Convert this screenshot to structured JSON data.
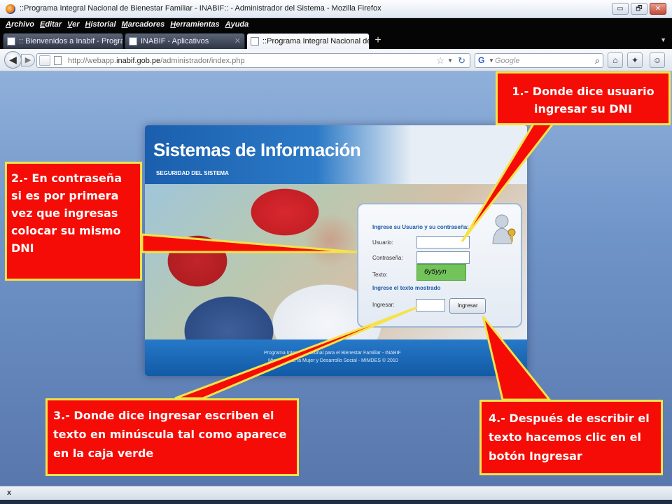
{
  "window": {
    "title": "::Programa Integral Nacional de Bienestar Familiar - INABIF:: - Administrador del Sistema - Mozilla Firefox",
    "minimize_label": "▭",
    "restore_label": "🗗",
    "close_label": "✕"
  },
  "menu": [
    "Archivo",
    "Editar",
    "Ver",
    "Historial",
    "Marcadores",
    "Herramientas",
    "Ayuda"
  ],
  "tabs": [
    {
      "label": ":: Bienvenidos a Inabif - Programa Int...",
      "active": false
    },
    {
      "label": "INABIF - Aplicativos",
      "active": false
    },
    {
      "label": "::Programa Integral Nacional de Bien...",
      "active": true
    }
  ],
  "toolbar": {
    "url_prefix": "http://webapp.",
    "url_domain": "inabif.gob.pe",
    "url_path": "/administrador/index.php",
    "search_placeholder": "Google"
  },
  "page": {
    "title": "Sistemas de Información",
    "subtitle": "SEGURIDAD DEL SISTEMA",
    "login_title": "Ingrese su Usuario y su contraseña:",
    "user_label": "Usuario:",
    "password_label": "Contraseña:",
    "text_label": "Texto:",
    "captcha_text": "6y5yyn",
    "captcha_prompt": "Ingrese el texto mostrado",
    "enter_label": "Ingresar:",
    "submit_label": "Ingresar",
    "footer_line1": "Programa Integral Nacional para el Bienestar Familiar - INABIF",
    "footer_line2": "Ministerio de la Mujer y Desarrollo Social - MIMDES © 2010"
  },
  "callouts": {
    "c1": "1.- Donde dice usuario ingresar su DNI",
    "c2": "2.- En contraseña si es por primera vez que ingresas colocar su mismo DNI",
    "c3": "3.- Donde dice ingresar escriben el texto en minúscula tal como aparece en la caja verde",
    "c4": "4.- Después de escribir el texto hacemos clic en el botón Ingresar"
  },
  "colors": {
    "callout_bg": "#f50c06",
    "callout_border": "#f6e24a",
    "captcha_bg": "#72c45a"
  },
  "status": {
    "close_label": "x"
  }
}
